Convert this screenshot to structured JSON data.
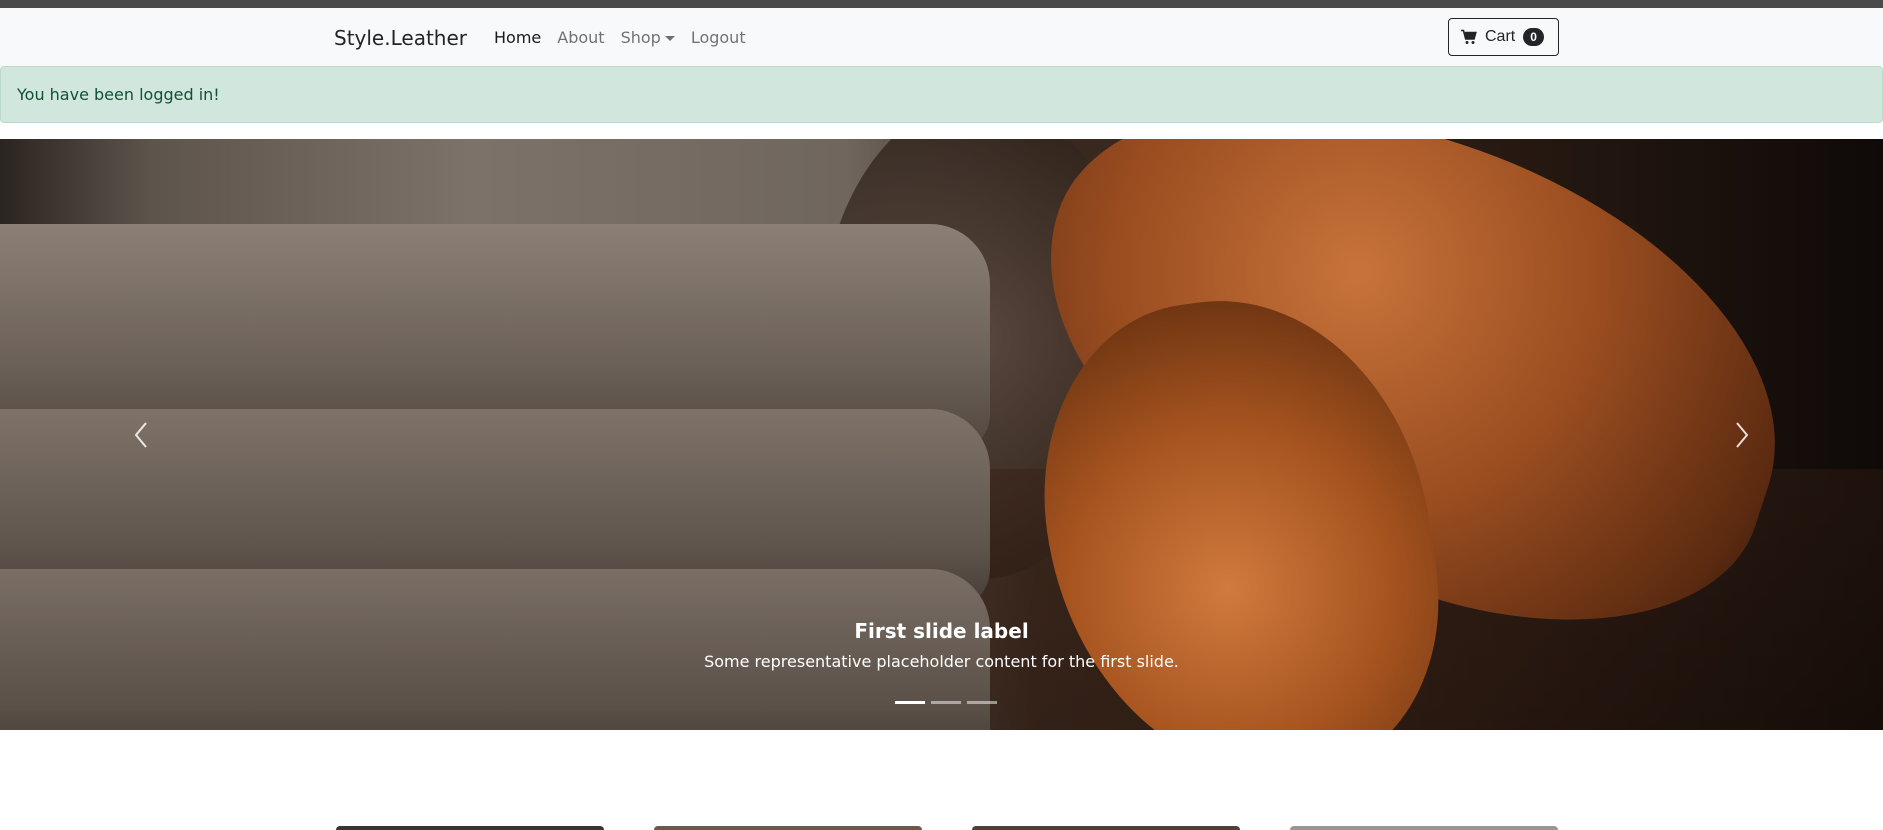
{
  "navbar": {
    "brand": "Style.Leather",
    "links": [
      {
        "label": "Home"
      },
      {
        "label": "About"
      },
      {
        "label": "Shop"
      },
      {
        "label": "Logout"
      }
    ],
    "cart": {
      "label": "Cart",
      "count": "0"
    }
  },
  "alert": {
    "message": "You have been logged in!"
  },
  "carousel": {
    "slide_title": "First slide label",
    "slide_text": "Some representative placeholder content for the first slide.",
    "indicators": 3,
    "active_index": 0
  },
  "colors": {
    "alert_bg": "#d1e7dd",
    "alert_text": "#0f5132",
    "navbar_bg": "#f8f9fa",
    "badge_bg": "#212529"
  }
}
